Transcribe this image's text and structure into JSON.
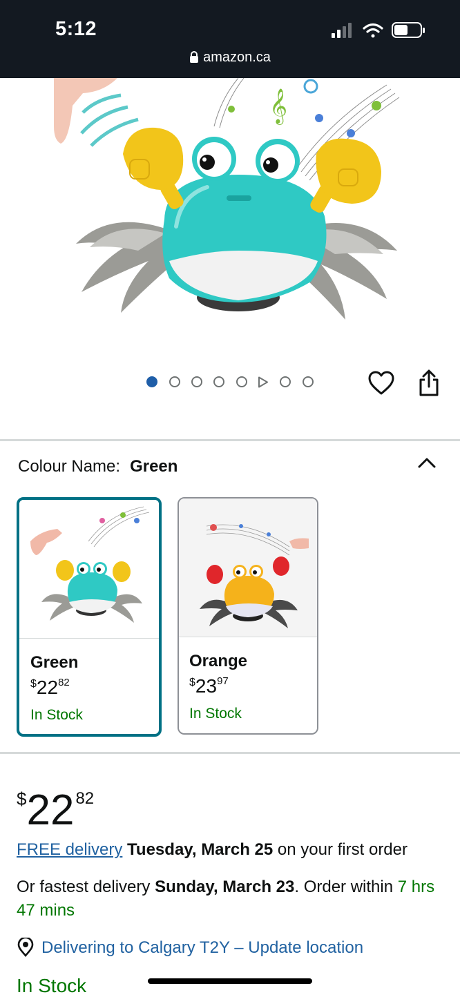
{
  "status_bar": {
    "time": "5:12",
    "url": "amazon.ca"
  },
  "gallery": {
    "image_count": 8,
    "active_index": 0,
    "video_index": 5
  },
  "colour": {
    "label": "Colour Name:",
    "selected": "Green"
  },
  "variants": [
    {
      "name": "Green",
      "price_dollars": "22",
      "price_cents": "82",
      "stock": "In Stock",
      "selected": true
    },
    {
      "name": "Orange",
      "price_dollars": "23",
      "price_cents": "97",
      "stock": "In Stock",
      "selected": false
    }
  ],
  "price": {
    "currency": "$",
    "dollars": "22",
    "cents": "82"
  },
  "delivery": {
    "free_link": "FREE delivery",
    "free_date": "Tuesday, March 25",
    "free_suffix": " on your first order",
    "fast_prefix": "Or fastest delivery ",
    "fast_date": "Sunday, March 23",
    "fast_middle": ". Order within ",
    "fast_countdown": "7 hrs 47 mins"
  },
  "location": {
    "text": "Delivering to Calgary T2Y – Update location"
  },
  "availability": "In Stock",
  "colors": {
    "link": "#2162a1",
    "stock_green": "#007600",
    "selected_border": "#007185",
    "header_bg": "#131921"
  }
}
